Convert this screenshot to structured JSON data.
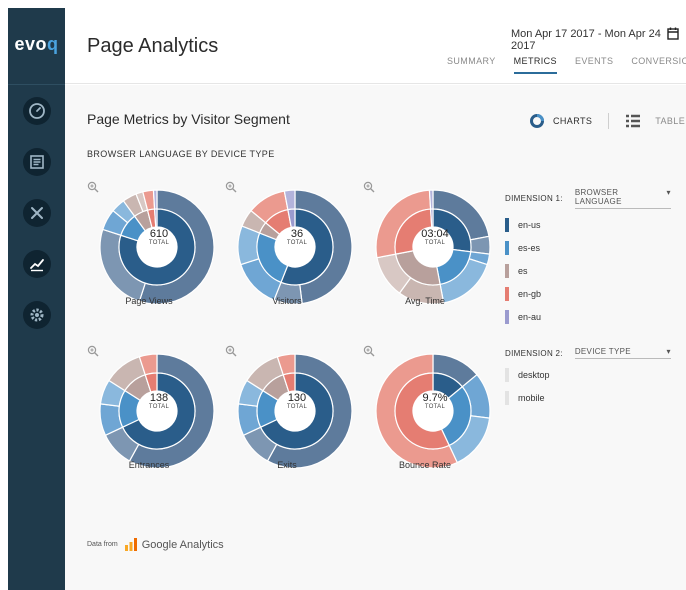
{
  "sidebar": {
    "logo_text": "evo",
    "logo_accent": "q",
    "items": [
      {
        "icon": "dashboard-icon"
      },
      {
        "icon": "content-icon"
      },
      {
        "icon": "tools-icon"
      },
      {
        "icon": "analytics-icon"
      },
      {
        "icon": "settings-icon"
      }
    ]
  },
  "header": {
    "title": "Page Analytics",
    "date_range": "Mon Apr 17 2017 - Mon Apr 24 2017",
    "tabs": [
      {
        "label": "SUMMARY",
        "active": false
      },
      {
        "label": "METRICS",
        "active": true
      },
      {
        "label": "EVENTS",
        "active": false
      },
      {
        "label": "CONVERSIONS",
        "active": false
      }
    ]
  },
  "section": {
    "title": "Page Metrics by Visitor Segment",
    "subtitle": "BROWSER LANGUAGE BY DEVICE TYPE",
    "view_charts": "CHARTS",
    "view_table": "TABLE"
  },
  "colors": {
    "en-us": "#2a5d8a",
    "es-es": "#4a91c7",
    "es": "#b8a09c",
    "en-gb": "#e57d72",
    "en-au": "#9b9bcf",
    "desktop_outer": "#5e7b9c",
    "mobile_outer_es-es": "#8ab8dd"
  },
  "chart_data": [
    {
      "type": "pie",
      "title": "Page Views",
      "center_value": "610",
      "center_label": "TOTAL",
      "inner_categories": [
        "en-us",
        "es-es",
        "es",
        "en-gb",
        "en-au"
      ],
      "inner_values": [
        0.8,
        0.1,
        0.06,
        0.03,
        0.01
      ],
      "outer_values": [
        {
          "lang": "en-us",
          "device": "desktop",
          "value": 0.55
        },
        {
          "lang": "en-us",
          "device": "mobile",
          "value": 0.25
        },
        {
          "lang": "es-es",
          "device": "desktop",
          "value": 0.06
        },
        {
          "lang": "es-es",
          "device": "mobile",
          "value": 0.04
        },
        {
          "lang": "es",
          "device": "desktop",
          "value": 0.04
        },
        {
          "lang": "es",
          "device": "mobile",
          "value": 0.02
        },
        {
          "lang": "en-gb",
          "device": "desktop",
          "value": 0.03
        },
        {
          "lang": "en-au",
          "device": "desktop",
          "value": 0.01
        }
      ]
    },
    {
      "type": "pie",
      "title": "Visitors",
      "center_value": "36",
      "center_label": "TOTAL",
      "inner_categories": [
        "en-us",
        "es-es",
        "es",
        "en-gb",
        "en-au"
      ],
      "inner_values": [
        0.56,
        0.25,
        0.05,
        0.11,
        0.03
      ],
      "outer_values": [
        {
          "lang": "en-us",
          "device": "desktop",
          "value": 0.48
        },
        {
          "lang": "en-us",
          "device": "mobile",
          "value": 0.08
        },
        {
          "lang": "es-es",
          "device": "desktop",
          "value": 0.14
        },
        {
          "lang": "es-es",
          "device": "mobile",
          "value": 0.11
        },
        {
          "lang": "es",
          "device": "desktop",
          "value": 0.05
        },
        {
          "lang": "en-gb",
          "device": "desktop",
          "value": 0.11
        },
        {
          "lang": "en-au",
          "device": "desktop",
          "value": 0.03
        }
      ]
    },
    {
      "type": "pie",
      "title": "Avg. Time",
      "center_value": "03:04",
      "center_label": "TOTAL",
      "inner_categories": [
        "en-us",
        "es-es",
        "es",
        "en-gb",
        "en-au"
      ],
      "inner_values": [
        0.27,
        0.2,
        0.25,
        0.27,
        0.01
      ],
      "outer_values": [
        {
          "lang": "en-us",
          "device": "desktop",
          "value": 0.22
        },
        {
          "lang": "en-us",
          "device": "mobile",
          "value": 0.05
        },
        {
          "lang": "es-es",
          "device": "desktop",
          "value": 0.03
        },
        {
          "lang": "es-es",
          "device": "mobile",
          "value": 0.17
        },
        {
          "lang": "es",
          "device": "desktop",
          "value": 0.13
        },
        {
          "lang": "es",
          "device": "mobile",
          "value": 0.12
        },
        {
          "lang": "en-gb",
          "device": "desktop",
          "value": 0.27
        },
        {
          "lang": "en-au",
          "device": "desktop",
          "value": 0.01
        }
      ]
    },
    {
      "type": "pie",
      "title": "Entrances",
      "center_value": "138",
      "center_label": "TOTAL",
      "inner_categories": [
        "en-us",
        "es-es",
        "es",
        "en-gb",
        "en-au"
      ],
      "inner_values": [
        0.68,
        0.16,
        0.11,
        0.05,
        0.0
      ],
      "outer_values": [
        {
          "lang": "en-us",
          "device": "desktop",
          "value": 0.58
        },
        {
          "lang": "en-us",
          "device": "mobile",
          "value": 0.1
        },
        {
          "lang": "es-es",
          "device": "desktop",
          "value": 0.09
        },
        {
          "lang": "es-es",
          "device": "mobile",
          "value": 0.07
        },
        {
          "lang": "es",
          "device": "desktop",
          "value": 0.11
        },
        {
          "lang": "en-gb",
          "device": "desktop",
          "value": 0.05
        }
      ]
    },
    {
      "type": "pie",
      "title": "Exits",
      "center_value": "130",
      "center_label": "TOTAL",
      "inner_categories": [
        "en-us",
        "es-es",
        "es",
        "en-gb",
        "en-au"
      ],
      "inner_values": [
        0.68,
        0.16,
        0.11,
        0.05,
        0.0
      ],
      "outer_values": [
        {
          "lang": "en-us",
          "device": "desktop",
          "value": 0.58
        },
        {
          "lang": "en-us",
          "device": "mobile",
          "value": 0.1
        },
        {
          "lang": "es-es",
          "device": "desktop",
          "value": 0.09
        },
        {
          "lang": "es-es",
          "device": "mobile",
          "value": 0.07
        },
        {
          "lang": "es",
          "device": "desktop",
          "value": 0.11
        },
        {
          "lang": "en-gb",
          "device": "desktop",
          "value": 0.05
        }
      ]
    },
    {
      "type": "pie",
      "title": "Bounce Rate",
      "center_value": "9.7%",
      "center_label": "TOTAL",
      "inner_categories": [
        "en-us",
        "es-es",
        "es",
        "en-gb",
        "en-au"
      ],
      "inner_values": [
        0.14,
        0.29,
        0.0,
        0.57,
        0.0
      ],
      "outer_values": [
        {
          "lang": "en-us",
          "device": "desktop",
          "value": 0.14
        },
        {
          "lang": "es-es",
          "device": "desktop",
          "value": 0.13
        },
        {
          "lang": "es-es",
          "device": "mobile",
          "value": 0.16
        },
        {
          "lang": "en-gb",
          "device": "desktop",
          "value": 0.57
        }
      ]
    }
  ],
  "legend": {
    "dimension1_label": "DIMENSION 1:",
    "dimension1_value": "BROWSER LANGUAGE",
    "dimension1_items": [
      "en-us",
      "es-es",
      "es",
      "en-gb",
      "en-au"
    ],
    "dimension2_label": "DIMENSION 2:",
    "dimension2_value": "DEVICE TYPE",
    "dimension2_items": [
      "desktop",
      "mobile"
    ]
  },
  "footer": {
    "data_from": "Data from",
    "provider": "Google Analytics"
  }
}
